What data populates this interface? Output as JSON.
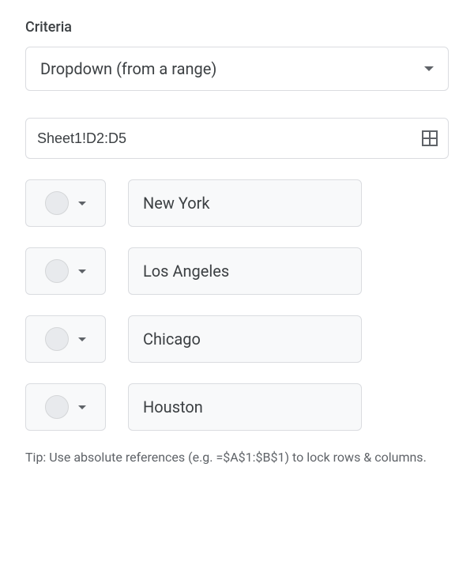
{
  "criteria": {
    "label": "Criteria",
    "dropdown": {
      "selected": "Dropdown (from a range)"
    },
    "range": {
      "value": "Sheet1!D2:D5"
    },
    "options": [
      {
        "label": "New York"
      },
      {
        "label": "Los Angeles"
      },
      {
        "label": "Chicago"
      },
      {
        "label": "Houston"
      }
    ],
    "tip": "Tip: Use absolute references (e.g. =$A$1:$B$1) to lock rows & columns."
  }
}
